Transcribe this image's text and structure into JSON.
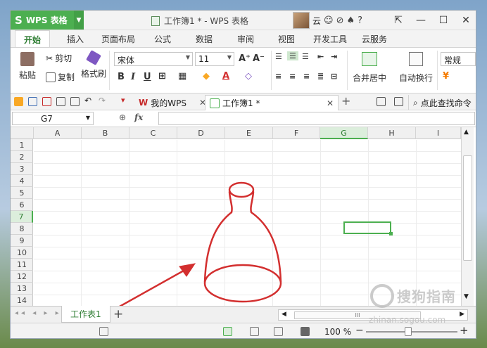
{
  "app": {
    "name": "WPS 表格",
    "logo_glyph": "S"
  },
  "window": {
    "title": "工作簿1 * - WPS 表格",
    "user_label": "云"
  },
  "menu": {
    "tabs": [
      "开始",
      "插入",
      "页面布局",
      "公式",
      "数据",
      "审阅",
      "视图",
      "开发工具",
      "云服务"
    ],
    "active": "开始"
  },
  "ribbon": {
    "paste": "粘贴",
    "cut": "剪切",
    "copy": "复制",
    "format_painter": "格式刷",
    "font_name": "宋体",
    "font_size": "11",
    "merge_center": "合并居中",
    "wrap_text": "自动换行",
    "number_format": "常规"
  },
  "quickbar": {
    "tabs": [
      {
        "label": "我的WPS"
      },
      {
        "label": "工作簿1 *"
      }
    ],
    "search_label": "点此查找命令"
  },
  "formula_bar": {
    "name_box": "G7",
    "fx": "fx",
    "value": ""
  },
  "grid": {
    "columns": [
      "A",
      "B",
      "C",
      "D",
      "E",
      "F",
      "G",
      "H",
      "I"
    ],
    "rows": [
      "1",
      "2",
      "3",
      "4",
      "5",
      "6",
      "7",
      "8",
      "9",
      "10",
      "11",
      "12",
      "13",
      "14"
    ],
    "selected_col": "G",
    "selected_row": "7",
    "drawing_color": "#d32f2f"
  },
  "sheets": {
    "tabs": [
      "工作表1"
    ],
    "scroll_thumb": "III"
  },
  "status": {
    "zoom": "100 %"
  },
  "watermark": {
    "text": "搜狗指南",
    "url": "zhinan.sogou.com"
  },
  "colors": {
    "accent": "#4caf50",
    "drawing": "#d32f2f"
  }
}
